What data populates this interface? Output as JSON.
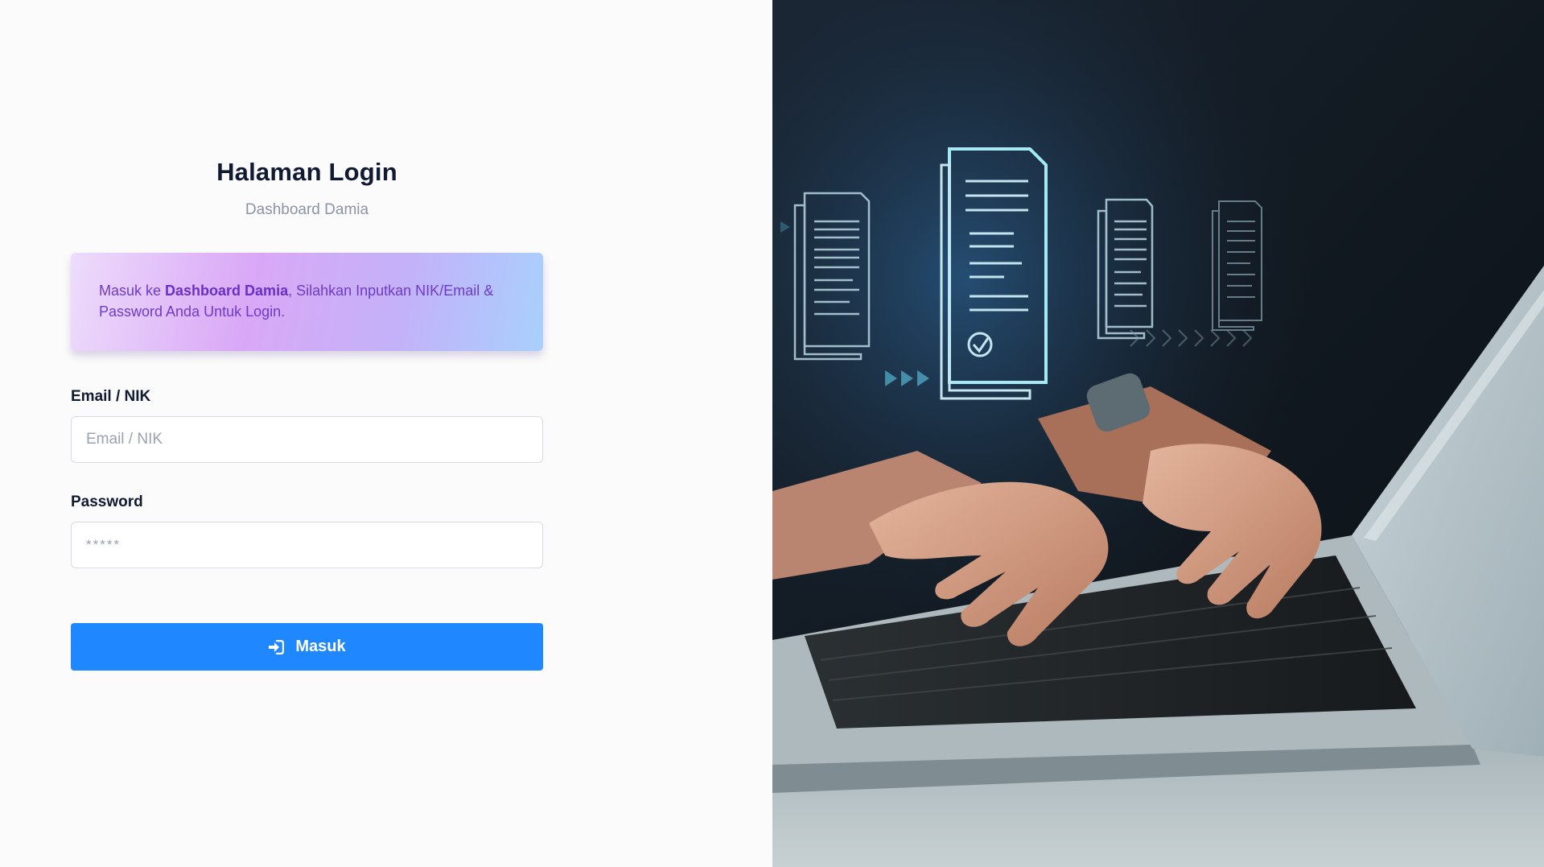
{
  "login": {
    "title": "Halaman Login",
    "subtitle": "Dashboard Damia",
    "alert": {
      "prefix": "Masuk ke ",
      "highlight": "Dashboard Damia",
      "suffix": ", Silahkan Inputkan NIK/Email & Password Anda Untuk Login."
    },
    "email": {
      "label": "Email / NIK",
      "placeholder": "Email / NIK",
      "value": ""
    },
    "password": {
      "label": "Password",
      "placeholder": "*****",
      "value": ""
    },
    "submit": {
      "label": "Masuk",
      "icon": "sign-in-icon"
    }
  },
  "hero_image": {
    "icon": "laptop-documents-illustration"
  },
  "colors": {
    "primary": "#1f87ff",
    "heading": "#111a33",
    "muted": "#8b93a5",
    "alert_text": "#6f3ac9",
    "background": "#fbfbfb"
  }
}
